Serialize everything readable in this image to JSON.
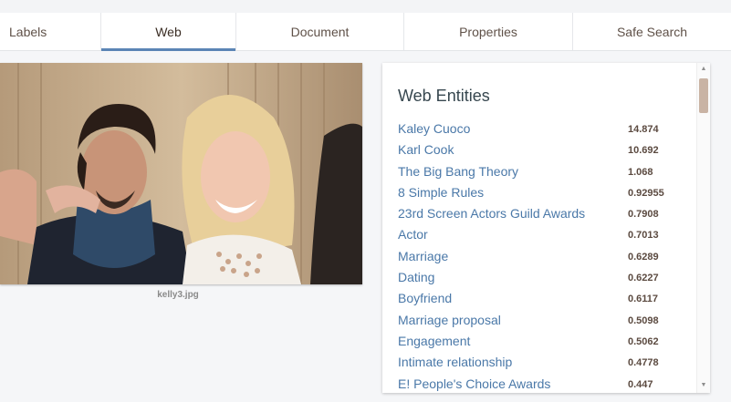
{
  "tabs": [
    {
      "label": "Labels"
    },
    {
      "label": "Web"
    },
    {
      "label": "Document"
    },
    {
      "label": "Properties"
    },
    {
      "label": "Safe Search"
    }
  ],
  "image": {
    "caption": "kelly3.jpg"
  },
  "web_entities": {
    "title": "Web Entities",
    "items": [
      {
        "name": "Kaley Cuoco",
        "score": "14.874"
      },
      {
        "name": "Karl Cook",
        "score": "10.692"
      },
      {
        "name": "The Big Bang Theory",
        "score": "1.068"
      },
      {
        "name": "8 Simple Rules",
        "score": "0.92955"
      },
      {
        "name": "23rd Screen Actors Guild Awards",
        "score": "0.7908"
      },
      {
        "name": "Actor",
        "score": "0.7013"
      },
      {
        "name": "Marriage",
        "score": "0.6289"
      },
      {
        "name": "Dating",
        "score": "0.6227"
      },
      {
        "name": "Boyfriend",
        "score": "0.6117"
      },
      {
        "name": "Marriage proposal",
        "score": "0.5098"
      },
      {
        "name": "Engagement",
        "score": "0.5062"
      },
      {
        "name": "Intimate relationship",
        "score": "0.4778"
      },
      {
        "name": "E! People's Choice Awards",
        "score": "0.447"
      }
    ]
  },
  "colors": {
    "tab_active_indicator": "#5b85b5",
    "entity_link": "#4a78a8"
  }
}
